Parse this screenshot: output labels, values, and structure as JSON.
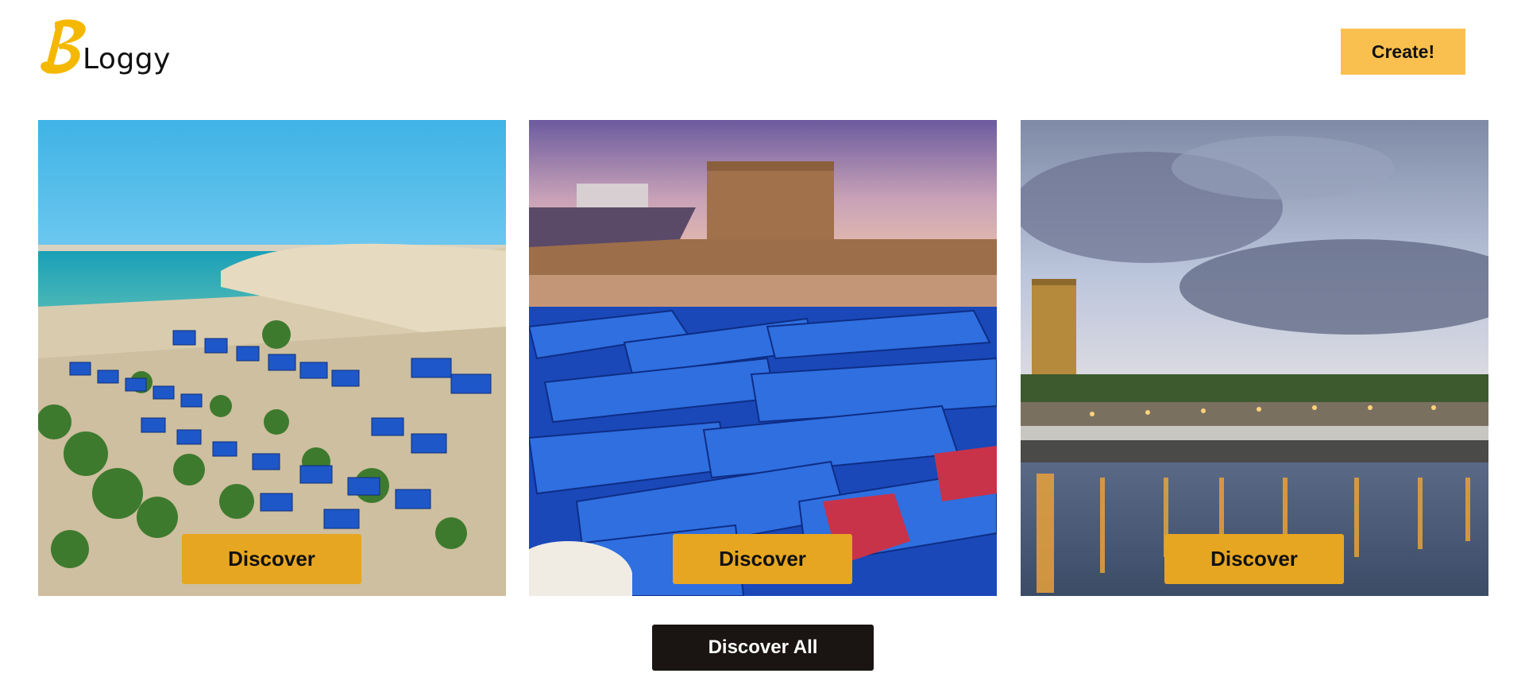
{
  "header": {
    "logo_letter": "B",
    "logo_text": "Loggy",
    "create_label": "Create!"
  },
  "cards": [
    {
      "discover_label": "Discover"
    },
    {
      "discover_label": "Discover"
    },
    {
      "discover_label": "Discover"
    }
  ],
  "discover_all_label": "Discover All",
  "colors": {
    "brand_yellow": "#f9c04f",
    "discover_gold": "#e7a621",
    "dark_button": "#1a1412"
  }
}
